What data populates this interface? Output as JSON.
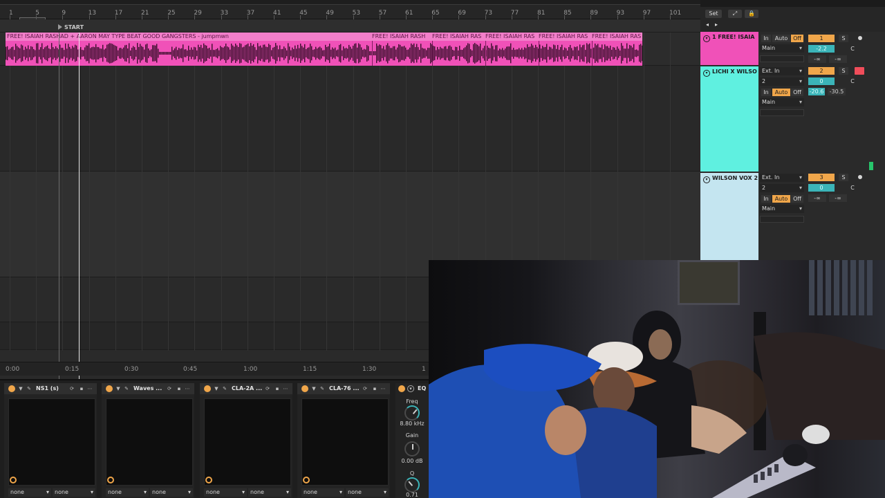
{
  "ruler": {
    "bars": [
      "1",
      "5",
      "9",
      "13",
      "17",
      "21",
      "25",
      "29",
      "33",
      "37",
      "41",
      "45",
      "49",
      "53",
      "57",
      "61",
      "65",
      "69",
      "73",
      "77",
      "81",
      "85",
      "89",
      "93",
      "97",
      "101"
    ]
  },
  "arrangement": {
    "start_label": "START",
    "clip_titles": [
      "FREE! ISAIAH RASHAD + AARON MAY TYPE BEAT GOOD GANGSTERS - jumpmwn",
      "FREE! ISAIAH RASH",
      "FREE! ISAIAH RAS",
      "FREE! ISAIAH RAS",
      "FREE! ISAIAH RAS",
      "FREE! ISAIAH RAS"
    ],
    "clip_color": "#f051b8"
  },
  "time_ruler": [
    "0:00",
    "0:15",
    "0:30",
    "0:45",
    "1:00",
    "1:15",
    "1:30",
    "1"
  ],
  "mixer": {
    "set_label": "Set",
    "tracks": [
      {
        "name": "1 FREE! ISAIA",
        "color": "#f051b8",
        "monitor": [
          "In",
          "Auto",
          "Off"
        ],
        "output": "Main",
        "number": "1",
        "solo": "S",
        "volume": "-2.2",
        "pan": "C",
        "sends": [
          "-∞",
          "-∞"
        ]
      },
      {
        "name": "LICHI X WILSO",
        "color": "#5ff0e0",
        "input": "Ext. In",
        "channel": "2",
        "monitor": [
          "In",
          "Auto",
          "Off"
        ],
        "output": "Main",
        "number": "2",
        "solo": "S",
        "volume": "0",
        "pan": "C",
        "peaks": [
          "-20.6",
          "-30.5"
        ]
      },
      {
        "name": "WILSON VOX 2",
        "color": "#c4e5f0",
        "input": "Ext. In",
        "channel": "2",
        "monitor": [
          "In",
          "Auto",
          "Off"
        ],
        "output": "Main",
        "number": "3",
        "solo": "S",
        "volume": "0",
        "pan": "C",
        "sends": [
          "-∞",
          "-∞"
        ]
      }
    ]
  },
  "devices": [
    {
      "name": "NS1 (s)",
      "selectors": [
        "none",
        "none"
      ]
    },
    {
      "name": "Waves ...",
      "selectors": [
        "none",
        "none"
      ]
    },
    {
      "name": "CLA-2A ...",
      "selectors": [
        "none",
        "none"
      ]
    },
    {
      "name": "CLA-76 ...",
      "selectors": [
        "none",
        "none"
      ]
    }
  ],
  "eq": {
    "title": "EQ",
    "freq_label": "Freq",
    "freq_value": "8.80 kHz",
    "gain_label": "Gain",
    "gain_value": "0.00 dB",
    "q_label": "Q",
    "q_value": "0.71"
  },
  "colors": {
    "accent_orange": "#f0a64a",
    "teal": "#3bb4b8",
    "record_red": "#f04d5a"
  }
}
